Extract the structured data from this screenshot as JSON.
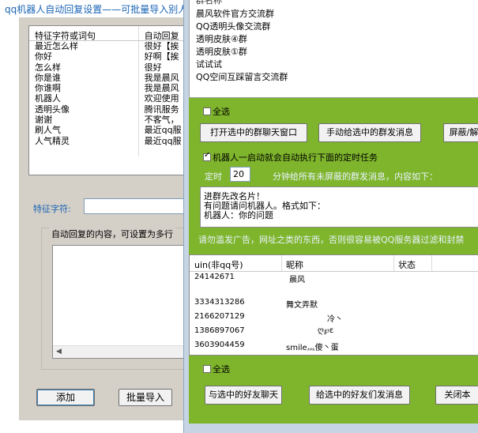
{
  "back_window": {
    "title": "qq机器人自动回复设置——可批量导入别人",
    "table": {
      "headers": [
        "特征字符或词句",
        "自动回复"
      ],
      "rows": [
        [
          "最近怎么样",
          "很好【挨"
        ],
        [
          "你好",
          "好啊【挨"
        ],
        [
          "怎么样",
          "很好"
        ],
        [
          "你是谁",
          "我是晨风"
        ],
        [
          "你谁啊",
          "我是晨风"
        ],
        [
          "机器人",
          "欢迎使用"
        ],
        [
          "透明头像",
          "腾讯服务"
        ],
        [
          "谢谢",
          "不客气，"
        ],
        [
          "刷人气",
          "最近qq服"
        ],
        [
          "人气精灵",
          "最近qq服"
        ],
        [
          "",
          ""
        ]
      ]
    },
    "keyword_label": "特征字符:",
    "keyword_value": "",
    "reply_group_label": "自动回复的内容，可设置为多行",
    "reply_value": "",
    "add_button": "添加",
    "batch_import_button": "批量导入"
  },
  "front_window": {
    "groups_header": "群名称",
    "groups": [
      "晨风软件官方交流群",
      "QQ透明头像交流群",
      "透明皮肤④群",
      "透明皮肤①群",
      "试试试",
      "QQ空间互踩留言交流群"
    ],
    "select_all_1": "全选",
    "open_chat_button": "打开选中的群聊天窗口",
    "manual_send_button": "手动给选中的群发消息",
    "block_button": "屏蔽/解",
    "auto_task_label": "机器人一启动就会自动执行下面的定时任务",
    "timer_prefix": "定时",
    "timer_minutes": "20",
    "timer_suffix": "分钟给所有未屏蔽的群发消息，内容如下：",
    "message_lines": [
      "进群先改名片！",
      "有问题请问机器人。格式如下：",
      "机器人：你的问题"
    ],
    "warning": "请勿滥发广告，网址之类的东西，否则很容易被QQ服务器过滤和封禁",
    "friends": {
      "headers": [
        "uin(非qq号)",
        "昵称",
        "状态"
      ],
      "rows": [
        [
          "24142671",
          "晨风",
          ""
        ],
        [
          "3334313286",
          "舞文弄默",
          ""
        ],
        [
          "2166207129",
          "冷丶",
          ""
        ],
        [
          "1386897067",
          "ღ℘ε",
          ""
        ],
        [
          "3603904459",
          "smile灬傻丶蛋",
          ""
        ]
      ]
    },
    "select_all_2": "全选",
    "chat_friend_button": "与选中的好友聊天",
    "send_friends_button": "给选中的好友们发消息",
    "close_button": "关闭本"
  }
}
